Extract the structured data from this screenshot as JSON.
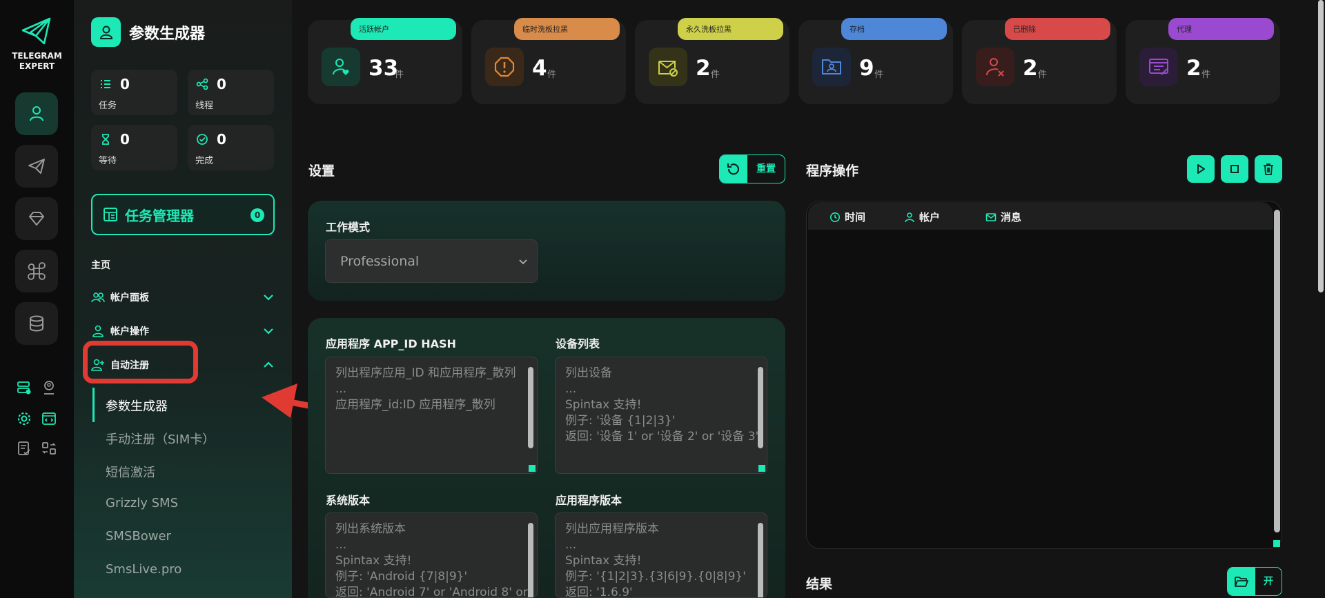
{
  "brand": {
    "name_line1": "TELEGRAM",
    "name_line2": "EXPERT"
  },
  "colors": {
    "accent": "#1de9b6",
    "danger": "#e13a32"
  },
  "rail": {
    "items": [
      "user-icon",
      "send-icon",
      "diamond-icon",
      "command-icon",
      "database-icon"
    ]
  },
  "sidebar": {
    "title": "参数生成器",
    "stats": [
      {
        "value": "0",
        "label": "任务"
      },
      {
        "value": "0",
        "label": "线程"
      },
      {
        "value": "0",
        "label": "等待"
      },
      {
        "value": "0",
        "label": "完成"
      }
    ],
    "task_manager": {
      "label": "任务管理器",
      "count": "0"
    },
    "nav": {
      "home": "主页",
      "account_panel": "帐户面板",
      "account_ops": "帐户操作",
      "auto_register": "自动注册"
    },
    "sub_items": [
      "参数生成器",
      "手动注册（SIM卡）",
      "短信激活",
      "Grizzly SMS",
      "SMSBower",
      "SmsLive.pro"
    ]
  },
  "cards": [
    {
      "label": "活跃帐户",
      "value": "33",
      "unit": "件",
      "color": "#1de9b6"
    },
    {
      "label": "临时洗板拉黑",
      "value": "4",
      "unit": "件",
      "color": "#d98b4a"
    },
    {
      "label": "永久洗板拉黑",
      "value": "2",
      "unit": "件",
      "color": "#cfd04a"
    },
    {
      "label": "存档",
      "value": "9",
      "unit": "件",
      "color": "#4e86d8"
    },
    {
      "label": "已删除",
      "value": "2",
      "unit": "件",
      "color": "#d84a4a"
    },
    {
      "label": "代理",
      "value": "2",
      "unit": "件",
      "color": "#9a4ad0"
    }
  ],
  "settings": {
    "title": "设置",
    "reset_label": "重置",
    "work_mode_label": "工作模式",
    "work_mode_value": "Professional",
    "app_hash": {
      "label": "应用程序 APP_ID HASH",
      "lines": [
        "列出程序应用_ID 和应用程序_散列",
        "...",
        "应用程序_id:ID 应用程序_散列"
      ]
    },
    "devices": {
      "label": "设备列表",
      "lines": [
        "列出设备",
        "...",
        "Spintax 支持!",
        "例子: '设备 {1|2|3}'",
        "返回: '设备 1' or '设备 2' or '设备 3'"
      ]
    },
    "system_version": {
      "label": "系统版本",
      "lines": [
        "列出系统版本",
        "...",
        "Spintax 支持!",
        "例子: 'Android {7|8|9}'",
        "返回: 'Android 7' or 'Android 8' or"
      ]
    },
    "app_version": {
      "label": "应用程序版本",
      "lines": [
        "列出应用程序版本",
        "...",
        "Spintax 支持!",
        "例子: '{1|2|3}.{3|6|9}.{0|8|9}'",
        "返回: '1.6.9'"
      ]
    }
  },
  "program": {
    "title": "程序操作",
    "columns": [
      "时间",
      "帐户",
      "消息"
    ],
    "result_title": "结果",
    "open_label": "开"
  }
}
